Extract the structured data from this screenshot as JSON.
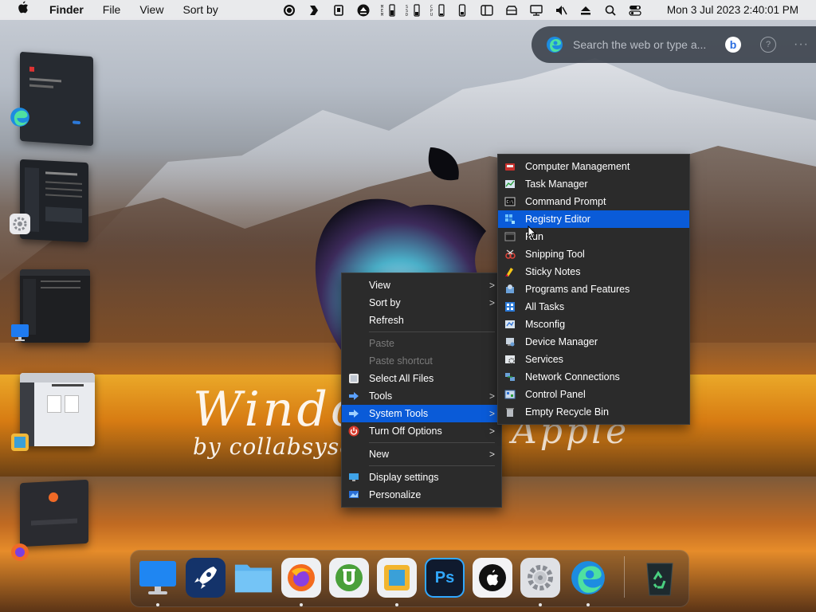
{
  "menubar": {
    "app_name": "Finder",
    "items": [
      "File",
      "View",
      "Sort by"
    ],
    "clock": "Mon 3 Jul 2023  2:40:01 PM",
    "status_icons": [
      "record-icon",
      "copilot-icon",
      "clipboard-icon",
      "eject-icon",
      "memory-icon",
      "disk-icon",
      "cpu-icon",
      "battery-phone-icon",
      "sidebar-icon",
      "drive-icon",
      "display-icon",
      "mute-icon",
      "eject-up-icon",
      "search-icon",
      "control-center-icon"
    ]
  },
  "edge_search": {
    "placeholder": "Search the web or type a...",
    "bing_label": "b",
    "help_label": "?",
    "more_label": "···"
  },
  "watermark": {
    "line1": "Windo",
    "line2": "by collabsyso",
    "line3": "Apple"
  },
  "context_menu": {
    "items": [
      {
        "label": "View",
        "submenu": true
      },
      {
        "label": "Sort by",
        "submenu": true
      },
      {
        "label": "Refresh"
      },
      {
        "label": "Paste",
        "disabled": true
      },
      {
        "label": "Paste shortcut",
        "disabled": true
      },
      {
        "label": "Select All Files"
      },
      {
        "label": "Tools",
        "submenu": true
      },
      {
        "label": "System Tools",
        "submenu": true,
        "highlighted": true
      },
      {
        "label": "Turn Off Options",
        "submenu": true
      },
      {
        "label": "New",
        "submenu": true
      },
      {
        "label": "Display settings"
      },
      {
        "label": "Personalize"
      }
    ],
    "arrow": ">"
  },
  "system_tools_menu": {
    "items": [
      {
        "label": "Computer Management"
      },
      {
        "label": "Task Manager"
      },
      {
        "label": "Command Prompt"
      },
      {
        "label": "Registry Editor",
        "highlighted": true
      },
      {
        "label": "Run"
      },
      {
        "label": "Snipping Tool"
      },
      {
        "label": "Sticky Notes"
      },
      {
        "label": "Programs and Features"
      },
      {
        "label": "All Tasks"
      },
      {
        "label": "Msconfig"
      },
      {
        "label": "Device Manager"
      },
      {
        "label": "Services"
      },
      {
        "label": "Network Connections"
      },
      {
        "label": "Control Panel"
      },
      {
        "label": "Empty Recycle Bin"
      }
    ]
  },
  "dock": {
    "apps": [
      "monitor-icon",
      "launchpad-icon",
      "folder-icon",
      "firefox-icon",
      "utorrent-icon",
      "window-app-icon",
      "photoshop-icon",
      "apple-store-icon",
      "settings-icon",
      "edge-icon",
      "recycle-bin-icon"
    ],
    "photoshop_label": "Ps"
  },
  "colors": {
    "menu_bg": "#2b2b2b",
    "highlight": "#0a5bd8",
    "menubar_bg": "#ececee"
  }
}
